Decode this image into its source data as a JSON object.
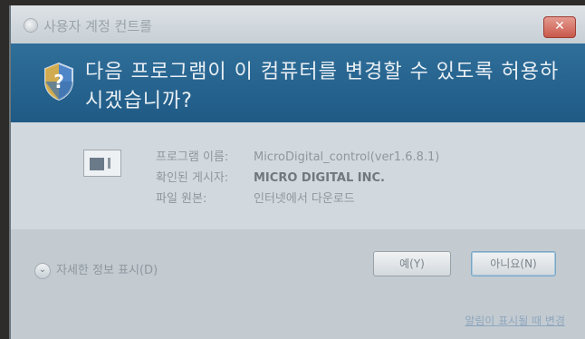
{
  "window": {
    "title": "사용자 계정 컨트롤",
    "close_label": "✕"
  },
  "banner": {
    "question": "다음 프로그램이 이 컴퓨터를 변경할 수 있도록 허용하시겠습니까?"
  },
  "program_info": {
    "name_label": "프로그램 이름:",
    "name_value": "MicroDigital_control(ver1.6.8.1)",
    "publisher_label": "확인된 게시자:",
    "publisher_value": "MICRO DIGITAL INC.",
    "origin_label": "파일 원본:",
    "origin_value": "인터넷에서 다운로드"
  },
  "footer": {
    "details_label": "자세한 정보 표시(D)",
    "yes_label": "예(Y)",
    "no_label": "아니요(N)",
    "change_link": "알림이 표시될 때 변경"
  },
  "icons": [
    "uac-shield-icon",
    "window-title-icon",
    "close-icon",
    "chevron-down-icon",
    "program-icon"
  ],
  "colors": {
    "banner": "#1f5a85",
    "close_button": "#c8584a"
  }
}
